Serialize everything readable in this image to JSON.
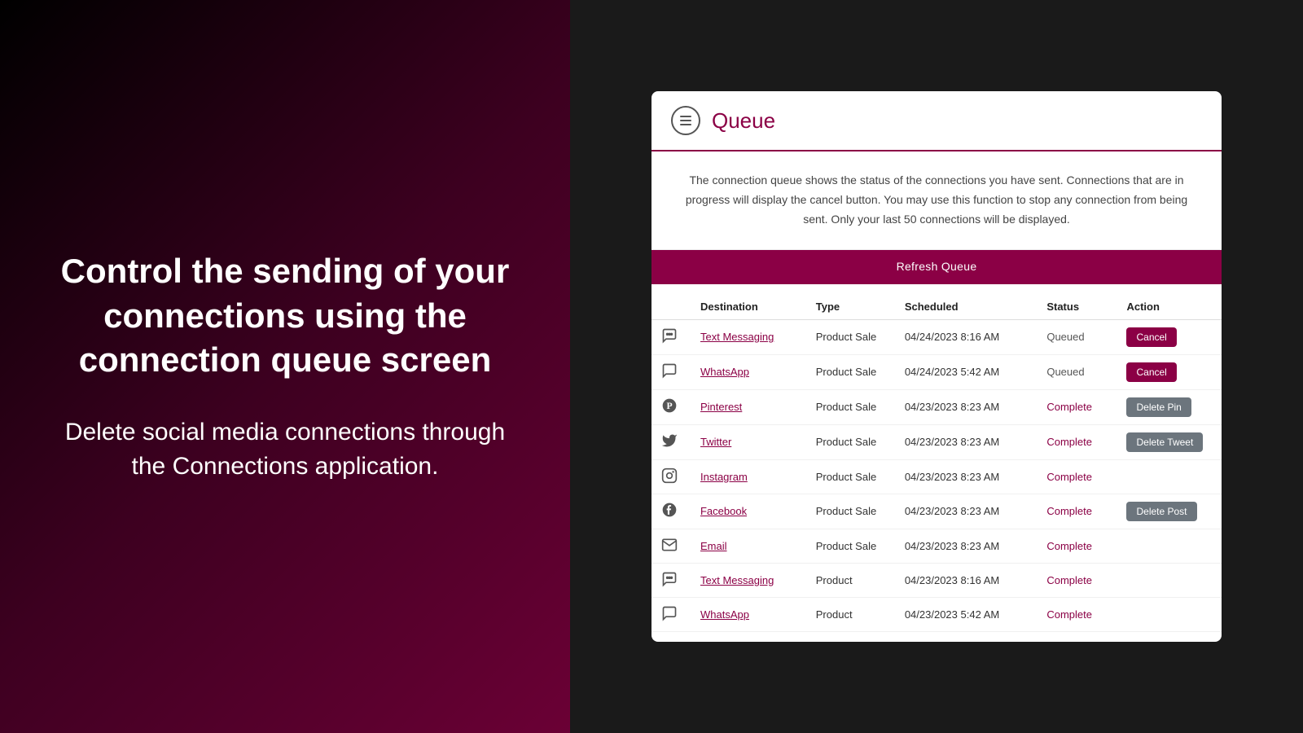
{
  "left": {
    "heading": "Control the sending of your connections using the connection queue screen",
    "subtext": "Delete social media connections through the Connections application."
  },
  "queue": {
    "title": "Queue",
    "menu_icon_label": "menu",
    "info_text": "The connection queue shows the status of the connections you have sent. Connections that are in progress will display the cancel button. You may use this function to stop any connection from being sent. Only your last 50 connections will be displayed.",
    "refresh_button_label": "Refresh Queue",
    "table": {
      "columns": [
        "",
        "Destination",
        "Type",
        "Scheduled",
        "Status",
        "Action"
      ],
      "rows": [
        {
          "icon": "💬",
          "icon_name": "text-messaging-icon",
          "destination": "Text Messaging",
          "type": "Product Sale",
          "scheduled": "04/24/2023 8:16 AM",
          "status": "Queued",
          "status_class": "queued",
          "action": "Cancel",
          "action_type": "cancel"
        },
        {
          "icon": "🅦",
          "icon_name": "whatsapp-icon",
          "destination": "WhatsApp",
          "type": "Product Sale",
          "scheduled": "04/24/2023 5:42 AM",
          "status": "Queued",
          "status_class": "queued",
          "action": "Cancel",
          "action_type": "cancel"
        },
        {
          "icon": "📌",
          "icon_name": "pinterest-icon",
          "destination": "Pinterest",
          "type": "Product Sale",
          "scheduled": "04/23/2023 8:23 AM",
          "status": "Complete",
          "status_class": "complete",
          "action": "Delete Pin",
          "action_type": "delete"
        },
        {
          "icon": "🐦",
          "icon_name": "twitter-icon",
          "destination": "Twitter",
          "type": "Product Sale",
          "scheduled": "04/23/2023 8:23 AM",
          "status": "Complete",
          "status_class": "complete",
          "action": "Delete Tweet",
          "action_type": "delete"
        },
        {
          "icon": "📷",
          "icon_name": "instagram-icon",
          "destination": "Instagram",
          "type": "Product Sale",
          "scheduled": "04/23/2023 8:23 AM",
          "status": "Complete",
          "status_class": "complete",
          "action": "",
          "action_type": "none"
        },
        {
          "icon": "🅕",
          "icon_name": "facebook-icon",
          "destination": "Facebook",
          "type": "Product Sale",
          "scheduled": "04/23/2023 8:23 AM",
          "status": "Complete",
          "status_class": "complete",
          "action": "Delete Post",
          "action_type": "delete"
        },
        {
          "icon": "✉",
          "icon_name": "email-icon",
          "destination": "Email",
          "type": "Product Sale",
          "scheduled": "04/23/2023 8:23 AM",
          "status": "Complete",
          "status_class": "complete",
          "action": "",
          "action_type": "none"
        },
        {
          "icon": "💬",
          "icon_name": "text-messaging-icon-2",
          "destination": "Text Messaging",
          "type": "Product",
          "scheduled": "04/23/2023 8:16 AM",
          "status": "Complete",
          "status_class": "complete",
          "action": "",
          "action_type": "none"
        },
        {
          "icon": "🅦",
          "icon_name": "whatsapp-icon-2",
          "destination": "WhatsApp",
          "type": "Product",
          "scheduled": "04/23/2023 5:42 AM",
          "status": "Complete",
          "status_class": "complete",
          "action": "",
          "action_type": "none"
        }
      ]
    }
  },
  "icons": {
    "text_messaging": "💬",
    "whatsapp": "⊙",
    "pinterest": "𝗣",
    "twitter": "🐦",
    "instagram": "⊚",
    "facebook": "🅕",
    "email": "✉"
  }
}
